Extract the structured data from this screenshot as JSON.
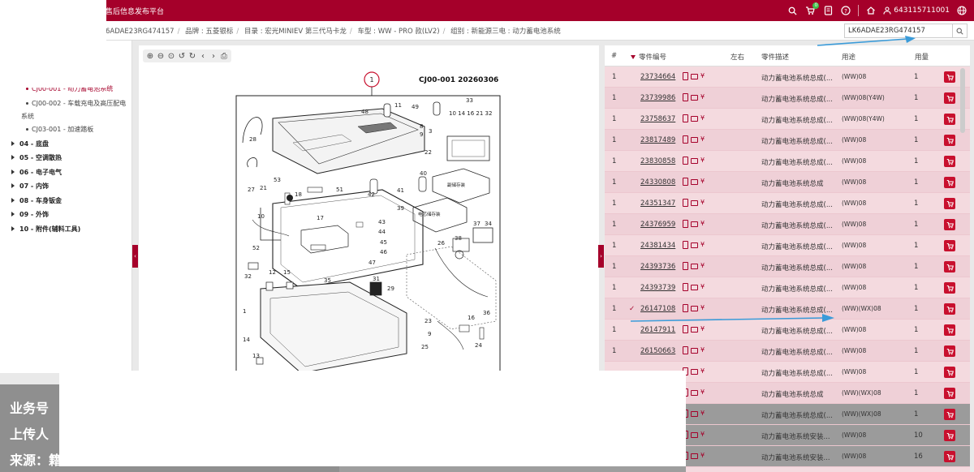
{
  "app": {
    "title": "售后信息发布平台"
  },
  "header": {
    "cart_badge": "0",
    "user_id": "643115711001"
  },
  "breadcrumb": {
    "vin": "6ADAE23RG474157",
    "brand": "品牌 : 五菱银标",
    "catalog": "目录 : 宏光MINIEV 第三代马卡龙",
    "model": "车型 : WW - PRO 款(LV2)",
    "group": "组别 : 新能源三电 : 动力蓄电池系统"
  },
  "search": {
    "value": "LK6ADAE23RG474157"
  },
  "tree": {
    "sub_items": [
      {
        "label": "CJ00-001 - 动力蓄电池系统",
        "active": true
      },
      {
        "label": "CJ00-002 - 车载充电及高压配电",
        "wrap": "系统"
      },
      {
        "label": "CJ03-001 - 加速踏板"
      }
    ],
    "nodes": [
      "04 - 底盘",
      "05 - 空调散热",
      "06 - 电子电气",
      "07 - 内饰",
      "08 - 车身钣金",
      "09 - 外饰",
      "10 - 附件(辅料工具)"
    ]
  },
  "diagram": {
    "code": "CJ00-001  20260306",
    "callout": "1",
    "badge1": "副储存装",
    "badge2": "电芯储存装"
  },
  "table": {
    "headers": {
      "index": "#",
      "part_no": "零件编号",
      "side": "左右",
      "desc": "零件描述",
      "use": "用途",
      "qty": "用量"
    },
    "rows": [
      {
        "idx": "1",
        "part": "23734664",
        "desc": "动力蓄电池系统总成(...",
        "use": "(WW)08",
        "qty": "1"
      },
      {
        "idx": "1",
        "part": "23739986",
        "desc": "动力蓄电池系统总成(...",
        "use": "(WW)08(Y4W)",
        "qty": "1"
      },
      {
        "idx": "1",
        "part": "23758637",
        "desc": "动力蓄电池系统总成(...",
        "use": "(WW)08(Y4W)",
        "qty": "1"
      },
      {
        "idx": "1",
        "part": "23817489",
        "desc": "动力蓄电池系统总成(...",
        "use": "(WW)08",
        "qty": "1"
      },
      {
        "idx": "1",
        "part": "23830858",
        "desc": "动力蓄电池系统总成(...",
        "use": "(WW)08",
        "qty": "1"
      },
      {
        "idx": "1",
        "part": "24330808",
        "desc": "动力蓄电池系统总成",
        "use": "(WW)08",
        "qty": "1"
      },
      {
        "idx": "1",
        "part": "24351347",
        "desc": "动力蓄电池系统总成(...",
        "use": "(WW)08",
        "qty": "1"
      },
      {
        "idx": "1",
        "part": "24376959",
        "desc": "动力蓄电池系统总成(...",
        "use": "(WW)08",
        "qty": "1"
      },
      {
        "idx": "1",
        "part": "24381434",
        "desc": "动力蓄电池系统总成(...",
        "use": "(WW)08",
        "qty": "1"
      },
      {
        "idx": "1",
        "part": "24393736",
        "desc": "动力蓄电池系统总成(...",
        "use": "(WW)08",
        "qty": "1"
      },
      {
        "idx": "1",
        "part": "24393739",
        "desc": "动力蓄电池系统总成(...",
        "use": "(WW)08",
        "qty": "1"
      },
      {
        "idx": "1",
        "part": "26147108",
        "desc": "动力蓄电池系统总成(...",
        "use": "(WW)(WX)08",
        "qty": "1",
        "checked": true
      },
      {
        "idx": "1",
        "part": "26147911",
        "desc": "动力蓄电池系统总成(...",
        "use": "(WW)08",
        "qty": "1"
      },
      {
        "idx": "1",
        "part": "26150663",
        "desc": "动力蓄电池系统总成(...",
        "use": "(WW)08",
        "qty": "1"
      },
      {
        "idx": "",
        "part": "",
        "desc": "动力蓄电池系统总成(...",
        "use": "(WW)08",
        "qty": "1"
      },
      {
        "idx": "",
        "part": "",
        "desc": "动力蓄电池系统总成",
        "use": "(WW)(WX)08",
        "qty": "1"
      },
      {
        "idx": "",
        "part": "",
        "desc": "动力蓄电池系统总成(...",
        "use": "(WW)(WX)08",
        "qty": "1"
      },
      {
        "idx": "",
        "part": "",
        "desc": "动力蓄电池系统安装...",
        "use": "(WW)08",
        "qty": "10"
      },
      {
        "idx": "",
        "part": "",
        "desc": "动力蓄电池系统安装...",
        "use": "(WW)08",
        "qty": "16"
      }
    ]
  },
  "overlay": {
    "line1": "业务号",
    "line2": "上传人",
    "line3": "来源：籍"
  },
  "colors": {
    "brand": "#a5002a",
    "cart": "#c8102e",
    "arrow": "#3a9bd9"
  }
}
